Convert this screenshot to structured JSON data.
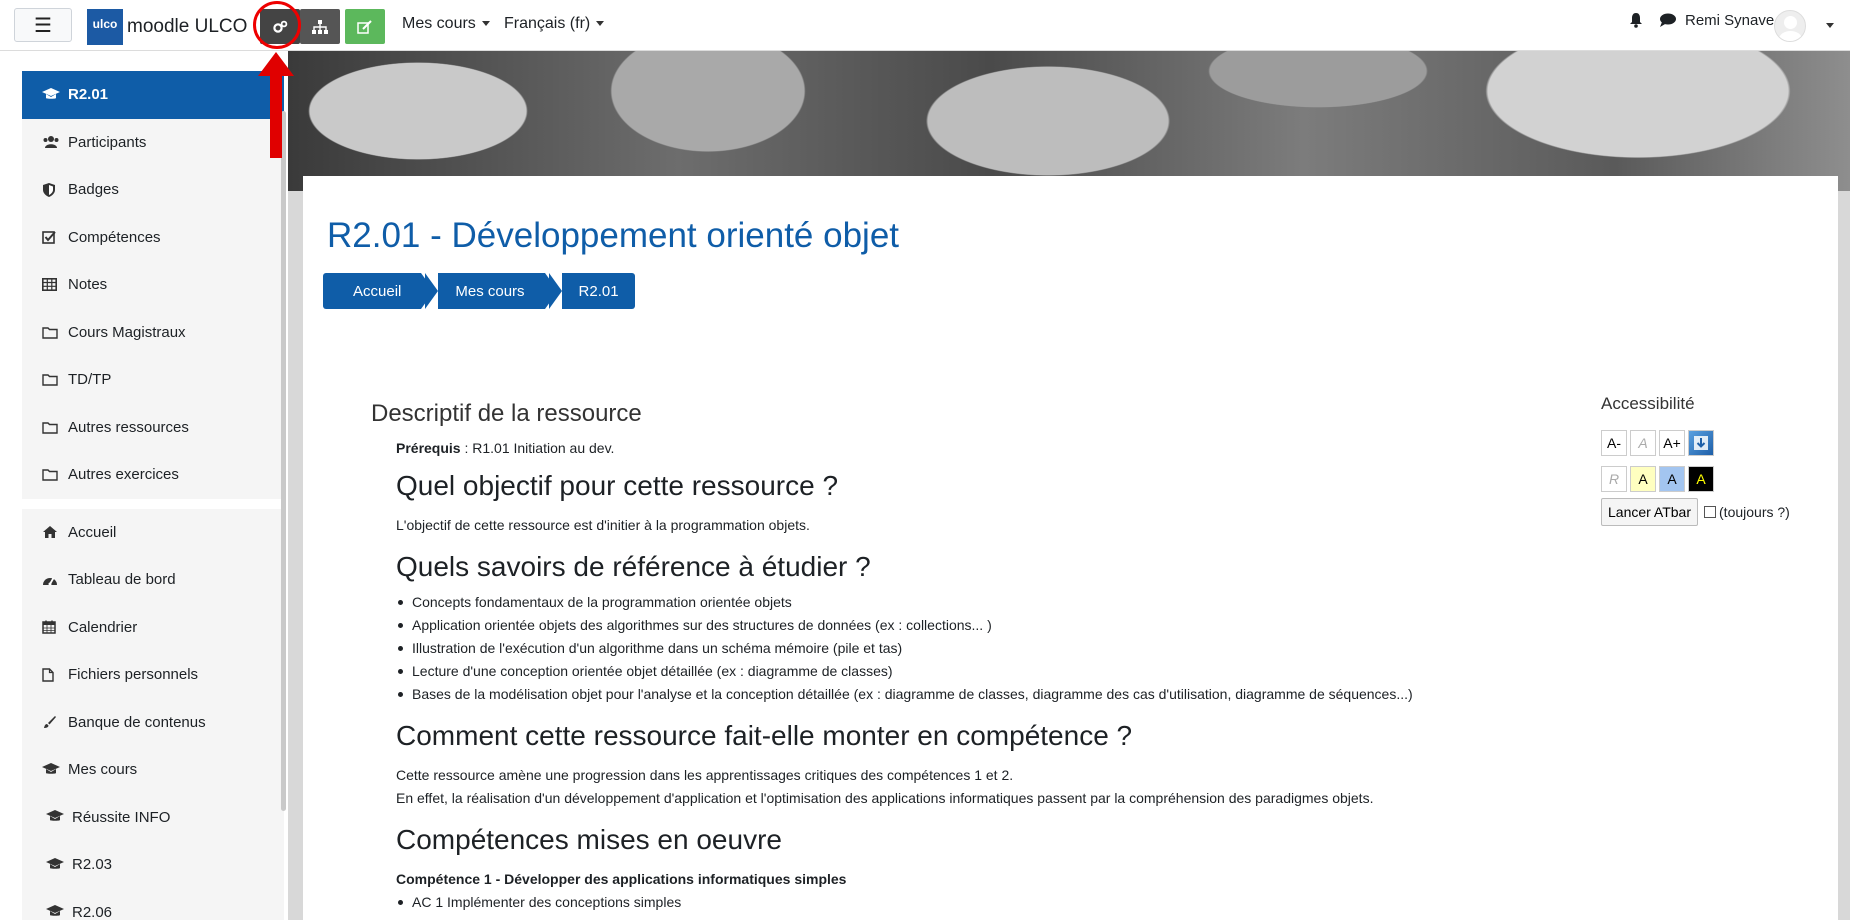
{
  "navbar": {
    "brand_logo": "ulco",
    "brand_name": "moodle ULCO",
    "mes_cours": "Mes cours",
    "language": "Français (fr)",
    "user_name": "Remi Synave"
  },
  "sidebar": {
    "course_items": [
      {
        "label": "R2.01",
        "icon": "graduation-cap-icon",
        "active": true
      },
      {
        "label": "Participants",
        "icon": "users-icon"
      },
      {
        "label": "Badges",
        "icon": "shield-icon"
      },
      {
        "label": "Compétences",
        "icon": "checkbox-icon"
      },
      {
        "label": "Notes",
        "icon": "table-icon"
      },
      {
        "label": "Cours Magistraux",
        "icon": "folder-icon"
      },
      {
        "label": "TD/TP",
        "icon": "folder-icon"
      },
      {
        "label": "Autres ressources",
        "icon": "folder-icon"
      },
      {
        "label": "Autres exercices",
        "icon": "folder-icon"
      }
    ],
    "site_items": [
      {
        "label": "Accueil",
        "icon": "home-icon"
      },
      {
        "label": "Tableau de bord",
        "icon": "dashboard-icon"
      },
      {
        "label": "Calendrier",
        "icon": "calendar-icon"
      },
      {
        "label": "Fichiers personnels",
        "icon": "file-icon"
      },
      {
        "label": "Banque de contenus",
        "icon": "paintbrush-icon"
      },
      {
        "label": "Mes cours",
        "icon": "graduation-cap-icon"
      },
      {
        "label": "Réussite INFO",
        "icon": "graduation-cap-icon"
      },
      {
        "label": "R2.03",
        "icon": "graduation-cap-icon"
      },
      {
        "label": "R2.06",
        "icon": "graduation-cap-icon"
      }
    ]
  },
  "page": {
    "title": "R2.01 - Développement orienté objet",
    "breadcrumb": [
      "Accueil",
      "Mes cours",
      "R2.01"
    ]
  },
  "content": {
    "section_title": "Descriptif de la ressource",
    "prereq_label": "Prérequis",
    "prereq_value": " : R1.01 Initiation au dev.",
    "h_objective": "Quel objectif pour cette ressource ?",
    "objective_text": "L'objectif de cette ressource est d'initier à la programmation objets.",
    "h_savoirs": "Quels savoirs de référence à étudier ?",
    "savoirs": [
      "Concepts fondamentaux de la programmation orientée objets",
      "Application orientée objets des algorithmes sur des structures de données (ex : collections... )",
      "Illustration de l'exécution d'un algorithme dans un schéma mémoire (pile et tas)",
      "Lecture d'une conception orientée objet détaillée (ex : diagramme de classes)",
      "Bases de la modélisation objet pour l'analyse et la conception détaillée (ex : diagramme de classes, diagramme des cas d'utilisation, diagramme de séquences...)"
    ],
    "h_competence": "Comment cette ressource fait-elle monter en compétence ?",
    "competence_text_1": "Cette ressource amène une progression dans les apprentissages critiques des compétences 1 et 2.",
    "competence_text_2": "En effet, la réalisation d'un développement d'application et l'optimisation des applications informatiques passent par la compréhension des paradigmes objets.",
    "h_mises": "Compétences mises en oeuvre",
    "competence_1": "Compétence 1 - Développer des applications informatiques simples",
    "ac_1": "AC 1 Implémenter des conceptions simples"
  },
  "accessibility": {
    "title": "Accessibilité",
    "font_minus": "A-",
    "font_reset": "A",
    "font_plus": "A+",
    "reset_color": "R",
    "yellow": "A",
    "blue": "A",
    "black": "A",
    "launch": "Lancer ATbar",
    "always": "(toujours ?)"
  },
  "colors": {
    "brand_blue": "#0f5da8",
    "edit_green": "#5cb85c",
    "annotation_red": "#e00000"
  }
}
